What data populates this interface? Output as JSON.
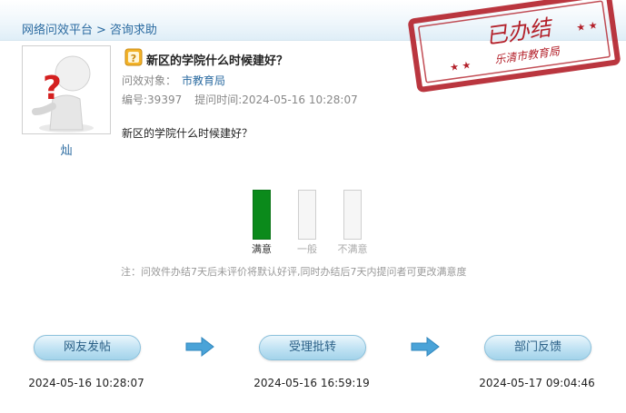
{
  "breadcrumb": {
    "root": "网络问效平台",
    "separator": ">",
    "current": "咨询求助"
  },
  "user": {
    "name": "灿"
  },
  "question": {
    "title": "新区的学院什么时候建好？",
    "target_label": "问效对象：",
    "target_value": "市教育局",
    "id_text": "编号:39397",
    "time_text": "提问时间:2024-05-16 10:28:07",
    "body": "新区的学院什么时候建好？"
  },
  "satisfaction": {
    "options": [
      {
        "label": "满意",
        "selected": true
      },
      {
        "label": "一般",
        "selected": false
      },
      {
        "label": "不满意",
        "selected": false
      }
    ],
    "note": "注：问效件办结7天后未评价将默认好评,同时办结后7天内提问者可更改满意度"
  },
  "stamp": {
    "main": "已办结",
    "sub": "乐清市教育局"
  },
  "workflow": [
    {
      "label": "网友发帖",
      "time": "2024-05-16 10:28:07"
    },
    {
      "label": "受理批转",
      "time": "2024-05-16 16:59:19"
    },
    {
      "label": "部门反馈",
      "time": "2024-05-17 09:04:46"
    }
  ],
  "colors": {
    "link": "#2a6aa0",
    "satisfied": "#0b8a1b",
    "stamp": "#b3202a"
  }
}
